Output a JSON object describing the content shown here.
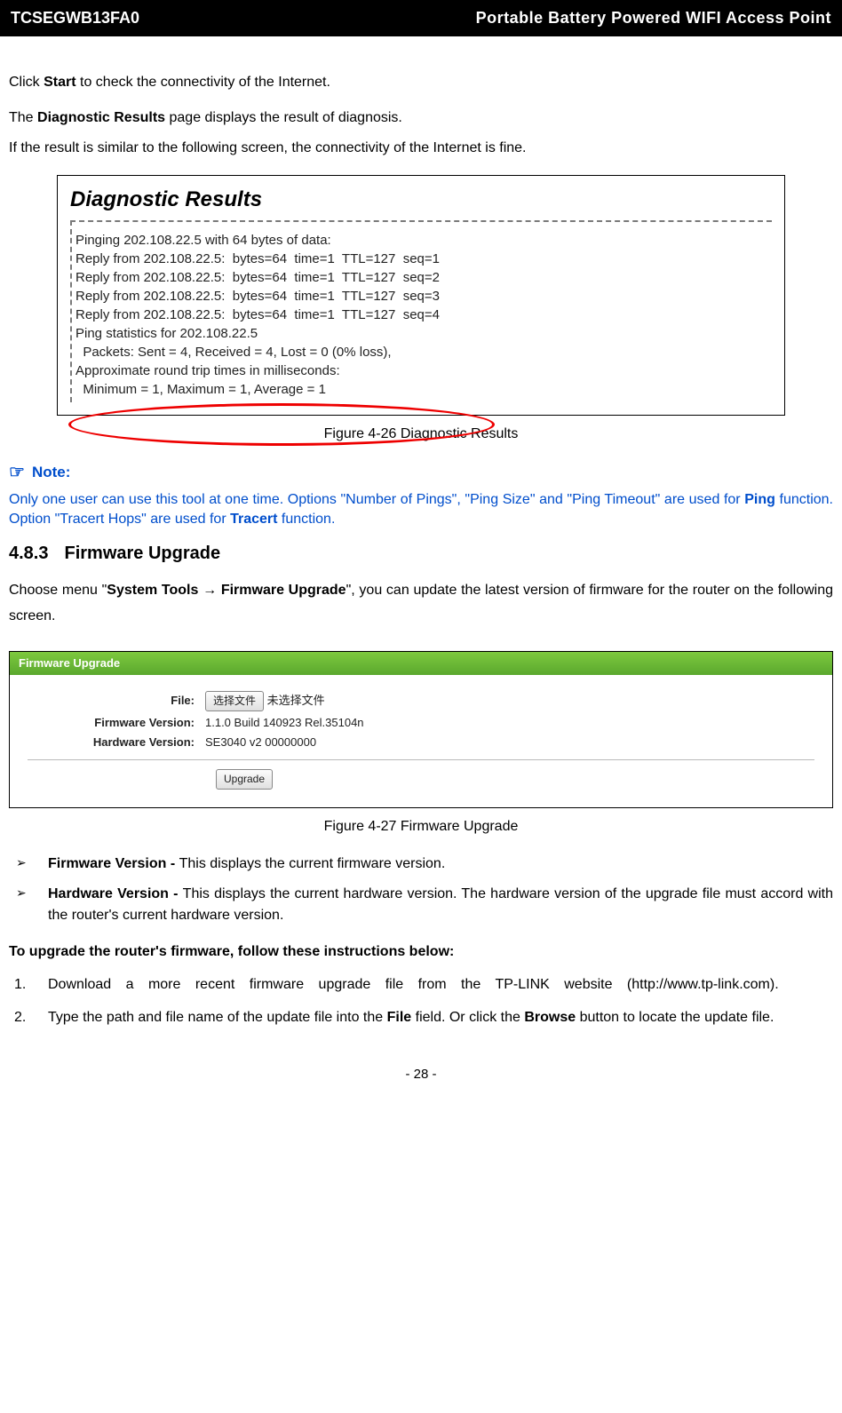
{
  "header": {
    "left": "TCSEGWB13FA0",
    "right": "Portable Battery Powered WIFI Access Point"
  },
  "intro": {
    "p1a": "Click ",
    "p1b": "Start",
    "p1c": " to check the connectivity of the Internet.",
    "p2a": "The ",
    "p2b": "Diagnostic Results",
    "p2c": " page displays the result of diagnosis.",
    "p3": "If the result is similar to the following screen, the connectivity of the Internet is fine."
  },
  "diag": {
    "title": "Diagnostic Results",
    "l1": "Pinging 202.108.22.5 with 64 bytes of data:",
    "l2": "",
    "l3": "Reply from 202.108.22.5:  bytes=64  time=1  TTL=127  seq=1",
    "l4": "Reply from 202.108.22.5:  bytes=64  time=1  TTL=127  seq=2",
    "l5": "Reply from 202.108.22.5:  bytes=64  time=1  TTL=127  seq=3",
    "l6": "Reply from 202.108.22.5:  bytes=64  time=1  TTL=127  seq=4",
    "l7": "",
    "l8": "Ping statistics for 202.108.22.5",
    "l9": "  Packets: Sent = 4, Received = 4, Lost = 0 (0% loss),",
    "l10": "Approximate round trip times in milliseconds:",
    "l11": "  Minimum = 1, Maximum = 1, Average = 1"
  },
  "captions": {
    "c1": "Figure 4-26    Diagnostic Results",
    "c2": "Figure 4-27    Firmware Upgrade"
  },
  "note": {
    "hdr": "Note:",
    "body_a": "Only one user can use this tool at one time. Options \"Number of Pings\", \"Ping Size\" and \"Ping Timeout\" are used for ",
    "body_b": "Ping",
    "body_c": " function. Option \"Tracert Hops\" are used for ",
    "body_d": "Tracert",
    "body_e": " function."
  },
  "section": {
    "num": "4.8.3",
    "title": "Firmware Upgrade",
    "p_a": "Choose menu \"",
    "p_b": "System Tools → Firmware Upgrade",
    "p_c": "\", you can update the latest version of firmware for the router on the following screen."
  },
  "fw": {
    "header": "Firmware Upgrade",
    "file_label": "File:",
    "choose_btn": "选择文件",
    "no_file": "未选择文件",
    "ver_label": "Firmware Version:",
    "ver_val": "1.1.0 Build 140923 Rel.35104n",
    "hw_label": "Hardware Version:",
    "hw_val": "SE3040 v2 00000000",
    "upgrade_btn": "Upgrade"
  },
  "bullets": {
    "b1_a": "Firmware Version - ",
    "b1_b": "This displays the current firmware version.",
    "b2_a": "Hardware Version - ",
    "b2_b": "This displays the current hardware version. The hardware version of the upgrade file must accord with the router's current hardware version."
  },
  "instr": {
    "title": "To upgrade the router's firmware, follow these instructions below:",
    "i1": "Download a more recent firmware upgrade file from the TP-LINK website (http://www.tp-link.com).",
    "i2_a": "Type the path and file name of the update file into the ",
    "i2_b": "File",
    "i2_c": " field. Or click the ",
    "i2_d": "Browse",
    "i2_e": " button to locate the update file."
  },
  "page_num": "- 28 -"
}
